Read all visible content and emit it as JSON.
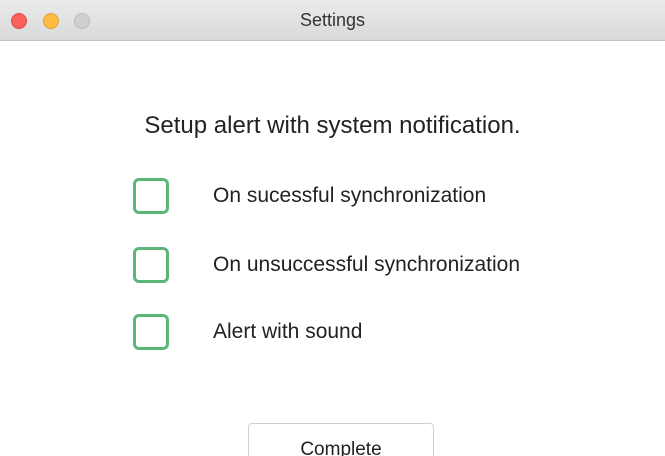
{
  "window": {
    "title": "Settings",
    "controls": {
      "close_color": "#fc605c",
      "minimize_color": "#fdbc40",
      "zoom_color": "#cfcfcf"
    }
  },
  "main": {
    "heading": "Setup alert with system notification.",
    "options": [
      {
        "label": "On sucessful synchronization",
        "checked": false
      },
      {
        "label": "On unsuccessful synchronization",
        "checked": false
      },
      {
        "label": "Alert with sound",
        "checked": false
      }
    ],
    "checkbox_color": "#5cb67a",
    "complete_label": "Complete"
  }
}
